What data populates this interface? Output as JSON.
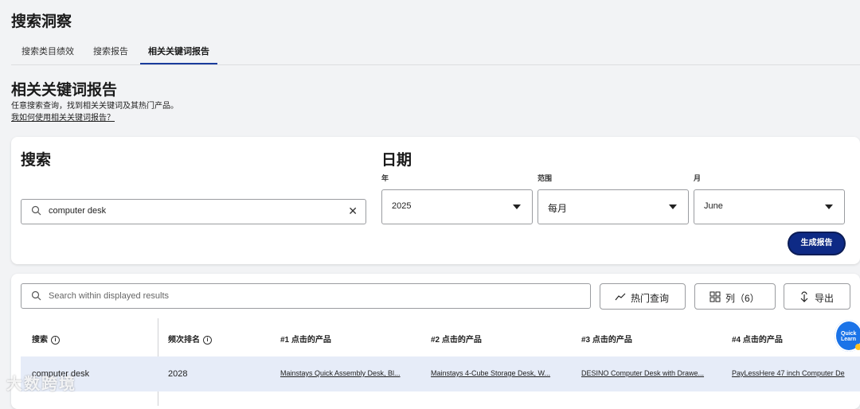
{
  "header": {
    "title": "搜索洞察"
  },
  "tabs": [
    {
      "label": "搜索类目绩效"
    },
    {
      "label": "搜索报告"
    },
    {
      "label": "相关关键词报告"
    }
  ],
  "section": {
    "title": "相关关键词报告",
    "description": "任意搜索查询，找到相关关键词及其热门产品。",
    "help_link": "我如何使用相关关键词报告？"
  },
  "search_panel": {
    "title": "搜索",
    "query_value": "computer desk"
  },
  "date_panel": {
    "title": "日期",
    "year_label": "年",
    "year_value": "2025",
    "range_label": "范围",
    "range_value": "每月",
    "month_label": "月",
    "month_value": "June",
    "generate_button": "生成报告"
  },
  "results": {
    "filter_placeholder": "Search within displayed results",
    "hot_queries_button": "热门查询",
    "columns_button": "列（6）",
    "export_button": "导出",
    "columns": [
      "搜索",
      "频次排名",
      "#1 点击的产品",
      "#2 点击的产品",
      "#3 点击的产品",
      "#4 点击的产品"
    ],
    "rows": [
      {
        "query": "computer desk",
        "rank": "2028",
        "p1": "Mainstays Quick Assembly Desk, Bl...",
        "p2": "Mainstays 4-Cube Storage Desk, W...",
        "p3": "DESINO Computer Desk with Drawe...",
        "p4": "PayLessHere 47 inch Computer De"
      }
    ]
  },
  "quick_learn": "Quick Learn",
  "watermark": "大数跨境",
  "colors": {
    "accent": "#1a3c9c",
    "button": "#0e2a85",
    "row_highlight": "#e6ecf8"
  }
}
